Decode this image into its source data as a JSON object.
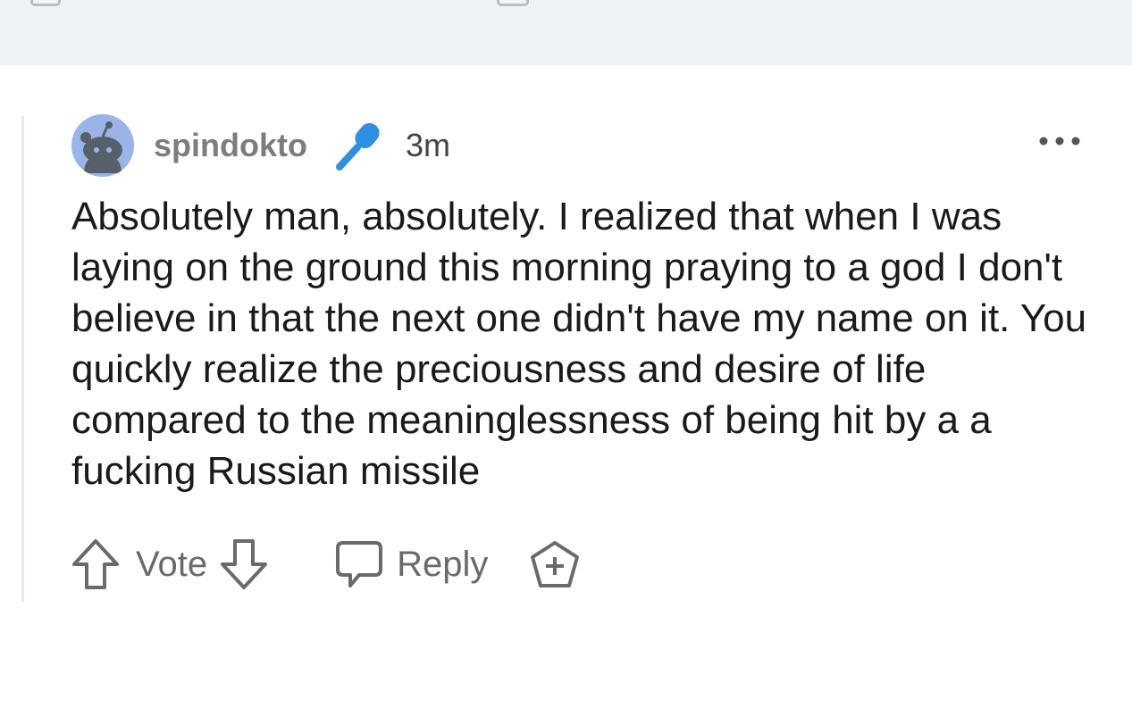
{
  "comment": {
    "username": "spindokto",
    "flair_icon": "microphone-icon",
    "timestamp": "3m",
    "body": "Absolutely man, absolutely. I realized that when I was laying on the ground this morning praying to a god I don't believe in that the next one didn't have my name on it. You quickly realize the preciousness and desire of life compared to the meaninglessness of being hit by a a fucking Russian missile"
  },
  "actions": {
    "vote_label": "Vote",
    "reply_label": "Reply",
    "upvote_icon": "arrow-up-icon",
    "downvote_icon": "arrow-down-icon",
    "reply_icon": "speech-bubble-icon",
    "award_icon": "award-plus-icon",
    "more_icon": "more-options-icon"
  },
  "colors": {
    "avatar_bg": "#9ab4e8",
    "flair_blue": "#2f8fe0",
    "muted_text": "#7c7c7c",
    "body_text": "#1a1a1b",
    "top_strip": "#eef3f6"
  }
}
